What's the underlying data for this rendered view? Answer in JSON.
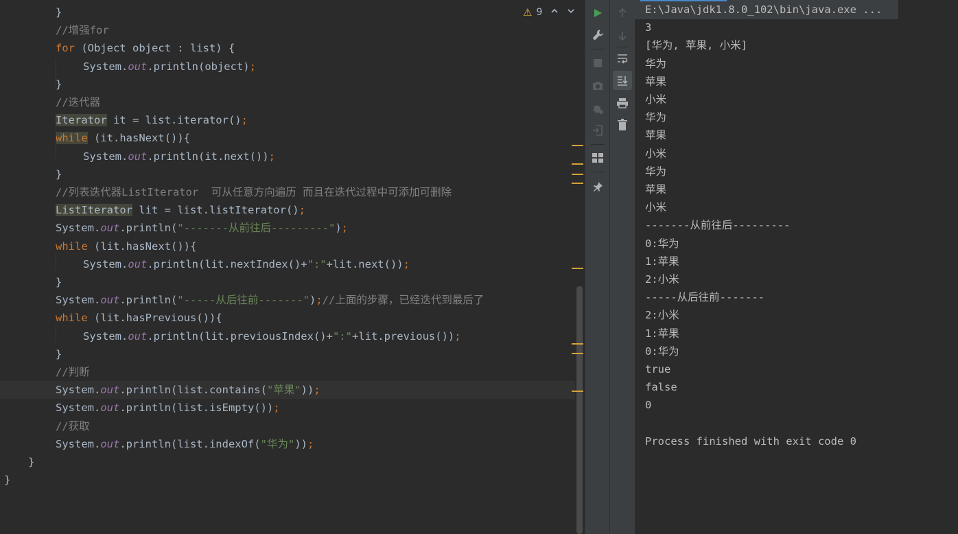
{
  "editor": {
    "inspection": {
      "warning_count": "9"
    },
    "lines": [
      {
        "indent": 2,
        "tokens": [
          {
            "t": "}"
          }
        ]
      },
      {
        "indent": 2,
        "tokens": [
          {
            "t": "//增强for",
            "c": "cm"
          }
        ]
      },
      {
        "indent": 2,
        "tokens": [
          {
            "t": "for",
            "c": "kw"
          },
          {
            "t": " (Object object : list) {"
          }
        ]
      },
      {
        "indent": 3,
        "tokens": [
          {
            "t": "System."
          },
          {
            "t": "out",
            "c": "fd"
          },
          {
            "t": ".println(object)"
          },
          {
            "t": ";",
            "c": "kw"
          }
        ]
      },
      {
        "indent": 2,
        "tokens": [
          {
            "t": "}"
          }
        ]
      },
      {
        "indent": 2,
        "tokens": [
          {
            "t": "//迭代器",
            "c": "cm"
          }
        ]
      },
      {
        "indent": 2,
        "tokens": [
          {
            "t": "Iterator",
            "c": "hl"
          },
          {
            "t": " it = list.iterator()"
          },
          {
            "t": ";",
            "c": "kw"
          }
        ]
      },
      {
        "indent": 2,
        "tokens": [
          {
            "t": "while",
            "c": "kw hl"
          },
          {
            "t": " (it.hasNext()){"
          }
        ]
      },
      {
        "indent": 3,
        "tokens": [
          {
            "t": "System."
          },
          {
            "t": "out",
            "c": "fd"
          },
          {
            "t": ".println(it.next())"
          },
          {
            "t": ";",
            "c": "kw"
          }
        ]
      },
      {
        "indent": 2,
        "tokens": [
          {
            "t": "}"
          }
        ]
      },
      {
        "indent": 2,
        "tokens": [
          {
            "t": "//列表迭代器ListIterator  可从任意方向遍历 而且在迭代过程中可添加可删除",
            "c": "cm"
          }
        ]
      },
      {
        "indent": 2,
        "tokens": [
          {
            "t": "ListIterator",
            "c": "hl"
          },
          {
            "t": " lit = list.listIterator()"
          },
          {
            "t": ";",
            "c": "kw"
          }
        ]
      },
      {
        "indent": 2,
        "tokens": [
          {
            "t": "System."
          },
          {
            "t": "out",
            "c": "fd"
          },
          {
            "t": ".println("
          },
          {
            "t": "\"-------从前往后---------\"",
            "c": "st"
          },
          {
            "t": ")"
          },
          {
            "t": ";",
            "c": "kw"
          }
        ]
      },
      {
        "indent": 2,
        "tokens": [
          {
            "t": "while",
            "c": "kw"
          },
          {
            "t": " (lit.hasNext()){"
          }
        ]
      },
      {
        "indent": 3,
        "tokens": [
          {
            "t": "System."
          },
          {
            "t": "out",
            "c": "fd"
          },
          {
            "t": ".println(lit.nextIndex()+"
          },
          {
            "t": "\":\"",
            "c": "st"
          },
          {
            "t": "+lit.next())"
          },
          {
            "t": ";",
            "c": "kw"
          }
        ]
      },
      {
        "indent": 2,
        "tokens": [
          {
            "t": "}"
          }
        ]
      },
      {
        "indent": 2,
        "tokens": [
          {
            "t": "System."
          },
          {
            "t": "out",
            "c": "fd"
          },
          {
            "t": ".println("
          },
          {
            "t": "\"-----从后往前-------\"",
            "c": "st"
          },
          {
            "t": ")"
          },
          {
            "t": ";",
            "c": "kw"
          },
          {
            "t": "//上面的步骤，已经迭代到最后了",
            "c": "cm"
          }
        ]
      },
      {
        "indent": 2,
        "tokens": [
          {
            "t": "while",
            "c": "kw"
          },
          {
            "t": " (lit.hasPrevious()){"
          }
        ]
      },
      {
        "indent": 3,
        "tokens": [
          {
            "t": "System."
          },
          {
            "t": "out",
            "c": "fd"
          },
          {
            "t": ".println(lit.previousIndex()+"
          },
          {
            "t": "\":\"",
            "c": "st"
          },
          {
            "t": "+lit.previous())"
          },
          {
            "t": ";",
            "c": "kw"
          }
        ]
      },
      {
        "indent": 2,
        "tokens": [
          {
            "t": "}"
          }
        ]
      },
      {
        "indent": 2,
        "tokens": [
          {
            "t": "//判断",
            "c": "cm"
          }
        ]
      },
      {
        "indent": 2,
        "current": true,
        "tokens": [
          {
            "t": "System."
          },
          {
            "t": "out",
            "c": "fd"
          },
          {
            "t": ".println(list.contains("
          },
          {
            "t": "\"苹果\"",
            "c": "st"
          },
          {
            "t": "))"
          },
          {
            "t": ";",
            "c": "kw"
          }
        ]
      },
      {
        "indent": 2,
        "tokens": [
          {
            "t": "System."
          },
          {
            "t": "out",
            "c": "fd"
          },
          {
            "t": ".println(list.isEmpty())"
          },
          {
            "t": ";",
            "c": "kw"
          }
        ]
      },
      {
        "indent": 2,
        "tokens": [
          {
            "t": "//获取",
            "c": "cm"
          }
        ]
      },
      {
        "indent": 2,
        "tokens": [
          {
            "t": "System."
          },
          {
            "t": "out",
            "c": "fd"
          },
          {
            "t": ".println(list.indexOf("
          },
          {
            "t": "\"华为\"",
            "c": "st"
          },
          {
            "t": "))"
          },
          {
            "t": ";",
            "c": "kw"
          }
        ]
      },
      {
        "indent": 1,
        "tokens": [
          {
            "t": "}"
          }
        ]
      },
      {
        "indent": 0,
        "tokens": [
          {
            "t": "}"
          }
        ]
      }
    ]
  },
  "run_toolbar": {
    "left": [
      {
        "name": "run-icon",
        "active": false
      },
      {
        "name": "wrench-icon",
        "active": false
      },
      {
        "name": "stop-icon",
        "active": false
      },
      {
        "name": "camera-icon",
        "active": false
      },
      {
        "name": "debug-bug-icon",
        "active": false
      },
      {
        "name": "exit-icon",
        "active": false
      },
      {
        "name": "layout-icon",
        "active": false
      },
      {
        "name": "pin-icon",
        "active": false
      }
    ],
    "right": [
      {
        "name": "arrow-up-icon",
        "active": false
      },
      {
        "name": "arrow-down-icon",
        "active": false
      },
      {
        "name": "soft-wrap-icon",
        "active": false
      },
      {
        "name": "scroll-to-end-icon",
        "active": true
      },
      {
        "name": "print-icon",
        "active": false
      },
      {
        "name": "trash-icon",
        "active": false
      }
    ]
  },
  "console": {
    "lines": [
      "E:\\Java\\jdk1.8.0_102\\bin\\java.exe ...",
      "3",
      "[华为, 苹果, 小米]",
      "华为",
      "苹果",
      "小米",
      "华为",
      "苹果",
      "小米",
      "华为",
      "苹果",
      "小米",
      "-------从前往后---------",
      "0:华为",
      "1:苹果",
      "2:小米",
      "-----从后往前-------",
      "2:小米",
      "1:苹果",
      "0:华为",
      "true",
      "false",
      "0",
      "",
      "Process finished with exit code 0"
    ]
  },
  "colors": {
    "keyword": "#cc7832",
    "comment": "#808080",
    "string": "#6a8759",
    "field": "#9876aa",
    "text": "#a9b7c6",
    "warning": "#e0b43a",
    "marker": "#d6a238",
    "run_green": "#499c54"
  }
}
